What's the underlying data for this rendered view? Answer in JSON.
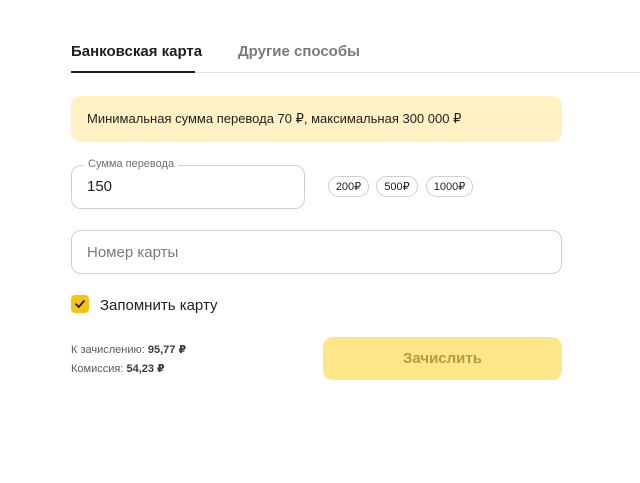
{
  "tabs": [
    {
      "label": "Банковская карта",
      "active": true
    },
    {
      "label": "Другие способы",
      "active": false
    }
  ],
  "notice": {
    "text": "Минимальная сумма перевода 70 ₽, максимальная 300 000 ₽"
  },
  "amount": {
    "label": "Сумма перевода",
    "value": "150"
  },
  "quick_amounts": [
    "200₽",
    "500₽",
    "1000₽"
  ],
  "card": {
    "placeholder": "Номер карты",
    "value": ""
  },
  "remember": {
    "label": "Запомнить карту",
    "checked": true
  },
  "summary": {
    "credit_label": "К зачислению:",
    "credit_value": "95,77 ₽",
    "fee_label": "Комиссия:",
    "fee_value": "54,23 ₽"
  },
  "submit": {
    "label": "Зачислить"
  },
  "colors": {
    "accent": "#f5c21b",
    "notice_bg": "#fff1c4",
    "button_disabled_bg": "#fde58a",
    "button_disabled_text": "#b39a47"
  }
}
